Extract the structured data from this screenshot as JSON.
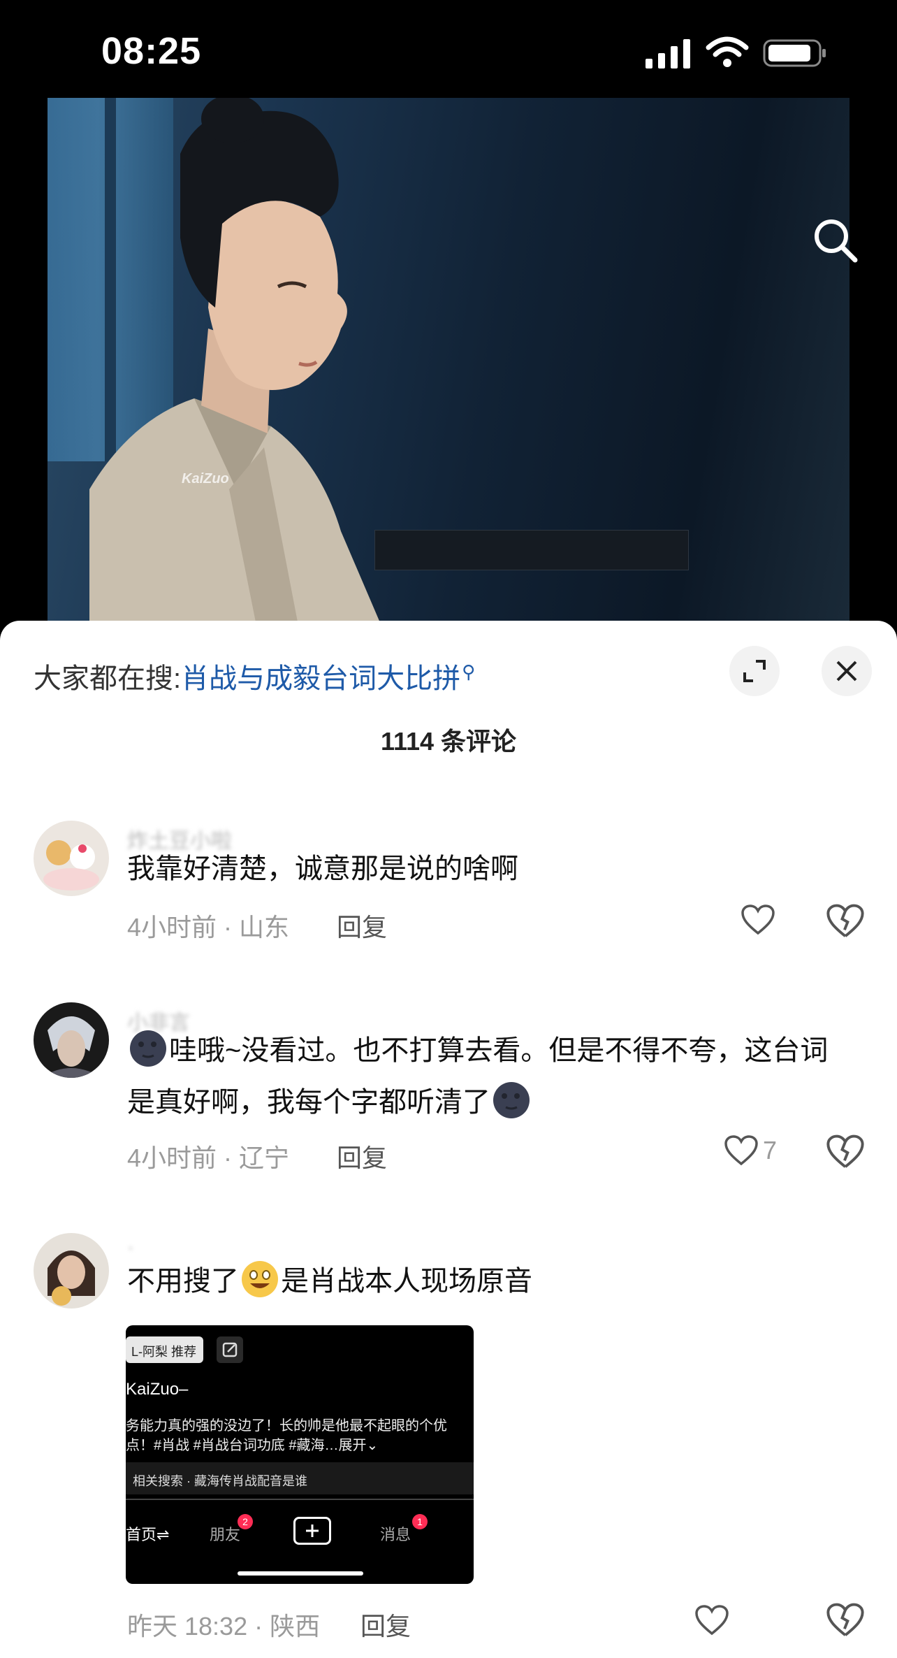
{
  "status_bar": {
    "time": "08:25"
  },
  "video": {
    "watermark": "KaiZuo"
  },
  "sheet": {
    "hot_search_prefix": "大家都在搜:",
    "hot_search_term": "肖战与成毅台词大比拼",
    "comment_count": "1114 条评论"
  },
  "comments": [
    {
      "username": "炸土豆小啦",
      "text": "我靠好清楚，诚意那是说的啥啊",
      "meta": "4小时前 · 山东",
      "reply": "回复",
      "likes": ""
    },
    {
      "username": "小非言",
      "text_part1": "哇哦~没看过。也不打算去看。但是不得不夸，这台词是真好啊，我每个字都听清了",
      "meta": "4小时前 · 辽宁",
      "reply": "回复",
      "likes": "7",
      "emoji": "new-moon-face"
    },
    {
      "username": "·",
      "text_part1": "不用搜了",
      "text_part2": "是肖战本人现场原音",
      "meta": "昨天 18:32 · 陕西",
      "reply": "回复",
      "emoji": "grinning-face",
      "embed": {
        "chip_label": "L-阿梨 推荐",
        "author": "KaiZuo–",
        "description": "务能力真的强的没边了！长的帅是他最不起眼的个优点！#肖战 #肖战台词功底 #藏海…展开⌄",
        "related": "相关搜索 · 藏海传肖战配音是谁",
        "nav_home": "首页⇌",
        "nav_friends": "朋友",
        "friends_badge": "2",
        "nav_messages": "消息",
        "messages_badge": "1"
      }
    }
  ]
}
